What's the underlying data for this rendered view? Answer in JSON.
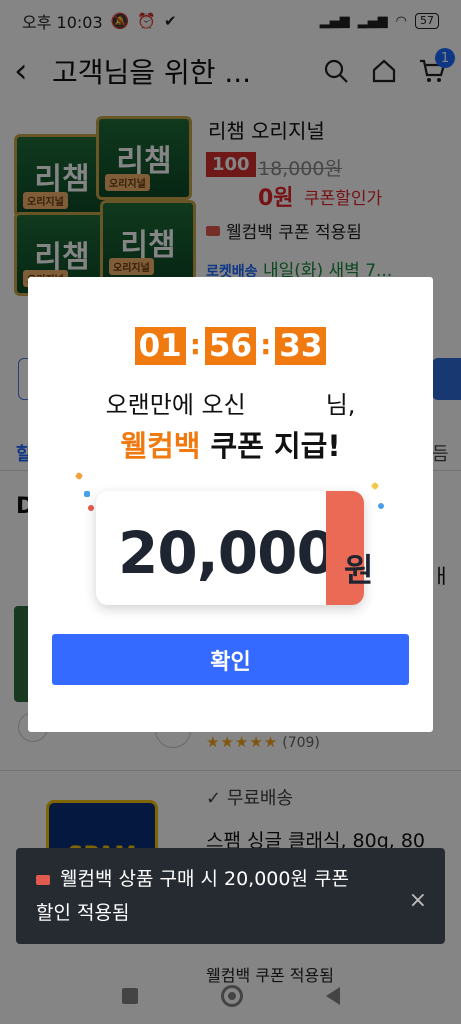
{
  "status_bar": {
    "time": "오후 10:03",
    "battery": "57"
  },
  "header": {
    "title": "고객님을 위한 ...",
    "cart_count": "1"
  },
  "product": {
    "name": "리챔 오리지널",
    "can_label": "리챔",
    "can_sub": "오리지널",
    "discount_badge": "100",
    "original_price": "18,000원",
    "price": "0원",
    "coupon_price_label": "쿠폰할인가",
    "coupon_applied": "웰컴백 쿠폰 적용됨",
    "delivery_badge": "로켓배송",
    "delivery_text": "내일(화) 새벽 7..."
  },
  "behind": {
    "tab_left": "할",
    "tab_right": "듬",
    "section_letter": "D",
    "right_fragment": "ㅐ",
    "rating_count": "(709)",
    "free_shipping": "무료배송",
    "spam_name": "스팸 싱글 클래식, 80g, 80",
    "spam_label": "SPAM",
    "bottom_fragment": "웰컴백 쿠폰 적용됨"
  },
  "modal": {
    "timer_h": "01",
    "timer_m": "56",
    "timer_s": "33",
    "greeting_pre": "오랜만에 오신",
    "greeting_post": "님,",
    "headline_accent": "웰컴백",
    "headline_rest": " 쿠폰 지급!",
    "amount": "20,000",
    "currency": "원",
    "confirm_label": "확인"
  },
  "toast": {
    "line1": "웰컴백 상품 구매 시 20,000원 쿠폰",
    "line2": "할인 적용됨",
    "close": "×"
  },
  "colors": {
    "accent_orange": "#f07a10",
    "primary_blue": "#346aff",
    "price_red": "#e52528",
    "coupon_stub": "#ea6a55"
  }
}
